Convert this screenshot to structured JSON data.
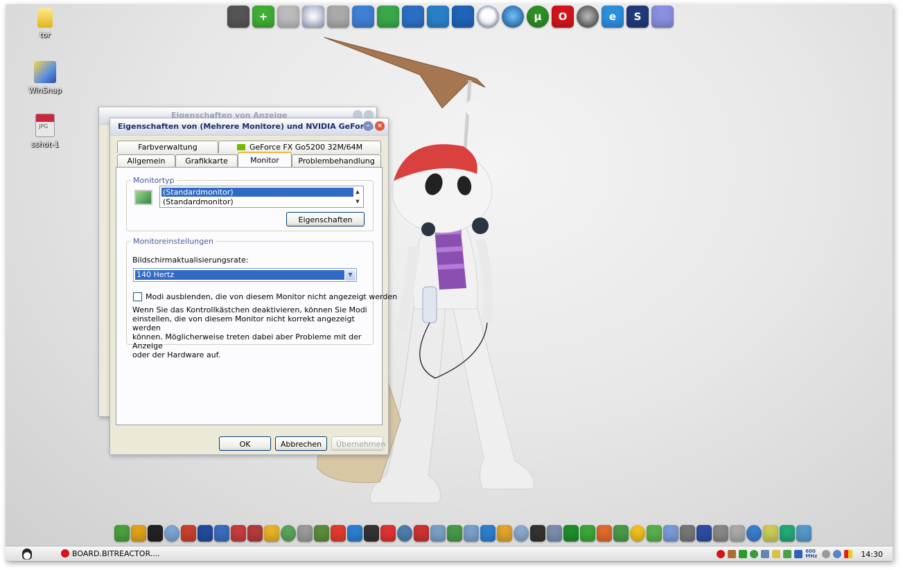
{
  "desktop": {
    "icons": [
      {
        "label": "tor"
      },
      {
        "label": "WinSnap"
      },
      {
        "label": "sshot-1"
      }
    ],
    "jpg_badge": "JPG"
  },
  "top_dock": {
    "items": [
      "monitor",
      "add",
      "file",
      "dvd",
      "file2",
      "folder",
      "recycle",
      "folder-blue",
      "network",
      "vista",
      "clock",
      "globe",
      "utorrent",
      "opera",
      "firefox",
      "ie",
      "script",
      "box"
    ]
  },
  "background_window": {
    "title": "Eigenschaften von Anzeige"
  },
  "dialog": {
    "title": "Eigenschaften von (Mehrere Monitore) und NVIDIA GeForce ...",
    "tabs_top": [
      "Farbverwaltung",
      "GeForce FX Go5200 32M/64M"
    ],
    "tabs_bottom": [
      "Allgemein",
      "Grafikkarte",
      "Monitor",
      "Problembehandlung"
    ],
    "active_tab": "Monitor",
    "monitortype": {
      "legend": "Monitortyp",
      "items": [
        "(Standardmonitor)",
        "(Standardmonitor)"
      ],
      "properties_button": "Eigenschaften"
    },
    "settings": {
      "legend": "Monitoreinstellungen",
      "refresh_label": "Bildschirmaktualisierungsrate:",
      "refresh_value": "140 Hertz",
      "hide_modes_label": "Modi ausblenden, die von diesem Monitor nicht angezeigt werden",
      "hide_modes_checked": false,
      "description_lines": [
        "Wenn Sie das Kontrollkästchen deaktivieren, können Sie Modi",
        "einstellen, die von diesem Monitor nicht korrekt angezeigt werden",
        "können. Möglicherweise treten dabei aber Probleme mit der Anzeige",
        "oder der Hardware auf."
      ]
    },
    "buttons": {
      "ok": "OK",
      "cancel": "Abbrechen",
      "apply": "Übernehmen"
    }
  },
  "bottom_dock": {
    "count": 42
  },
  "taskbar": {
    "task": "BOARD.BITREACTOR....",
    "cpu_label": "600 MHz",
    "clock": "14:30"
  },
  "colors": {
    "accent": "#316ac5",
    "title_text": "#1b2e6b",
    "tab_highlight": "#f4b43c"
  }
}
